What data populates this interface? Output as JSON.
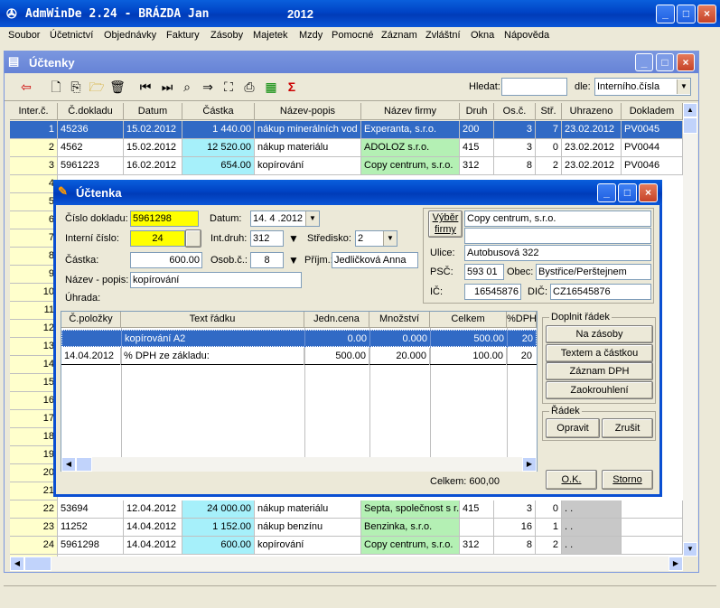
{
  "app": {
    "title": "AdmWinDe 2.24 - BRÁZDA Jan",
    "year": "2012"
  },
  "menu": [
    "Soubor",
    "Účetnictví",
    "Objednávky",
    "Faktury",
    "Zásoby",
    "Majetek",
    "Mzdy",
    "Pomocné",
    "Záznam",
    "Zvláštní",
    "Okna",
    "Nápověda"
  ],
  "child": {
    "title": "Účtenky",
    "search_label": "Hledat:",
    "search_value": "",
    "by_label": "dle:",
    "by_value": "Interního.čísla"
  },
  "columns": [
    "Inter.č.",
    "Č.dokladu",
    "Datum",
    "Částka",
    "Název-popis",
    "Název firmy",
    "Druh",
    "Os.č.",
    "Stř.",
    "Uhrazeno",
    "Dokladem"
  ],
  "rows_top": [
    {
      "n": "1",
      "doc": "45236",
      "date": "15.02.2012",
      "amt": "1 440.00",
      "desc": "nákup minerálních vod",
      "firm": "Experanta, s.r.o.",
      "druh": "200",
      "os": "3",
      "st": "7",
      "paid": "23.02.2012",
      "dokl": "PV0045"
    },
    {
      "n": "2",
      "doc": "4562",
      "date": "15.02.2012",
      "amt": "12 520.00",
      "desc": "nákup materiálu",
      "firm": "ADOLOZ s.r.o.",
      "druh": "415",
      "os": "3",
      "st": "0",
      "paid": "23.02.2012",
      "dokl": "PV0044"
    },
    {
      "n": "3",
      "doc": "5961223",
      "date": "16.02.2012",
      "amt": "654.00",
      "desc": "kopírování",
      "firm": "Copy centrum, s.r.o.",
      "druh": "312",
      "os": "8",
      "st": "2",
      "paid": "23.02.2012",
      "dokl": "PV0046"
    }
  ],
  "hidden_row_numbers": [
    "4",
    "5",
    "6",
    "7",
    "8",
    "9",
    "10",
    "11",
    "12",
    "13",
    "14",
    "15",
    "16",
    "17",
    "18",
    "19",
    "20",
    "21"
  ],
  "rows_bottom": [
    {
      "n": "22",
      "doc": "53694",
      "date": "12.04.2012",
      "amt": "24 000.00",
      "desc": "nákup materiálu",
      "firm": "Septa, společnost s r.o.",
      "druh": "415",
      "os": "3",
      "st": "0",
      "paid": ". .",
      "dokl": ""
    },
    {
      "n": "23",
      "doc": "11252",
      "date": "14.04.2012",
      "amt": "1 152.00",
      "desc": "nákup benzínu",
      "firm": "Benzinka, s.r.o.",
      "druh": "",
      "os": "16",
      "st": "1",
      "paid": ". .",
      "dokl": ""
    },
    {
      "n": "24",
      "doc": "5961298",
      "date": "14.04.2012",
      "amt": "600.00",
      "desc": "kopírování",
      "firm": "Copy centrum, s.r.o.",
      "druh": "312",
      "os": "8",
      "st": "2",
      "paid": ". .",
      "dokl": ""
    }
  ],
  "dialog": {
    "title": "Účtenka",
    "cislo_dokladu_label": "Číslo dokladu:",
    "cislo_dokladu": "5961298",
    "datum_label": "Datum:",
    "datum": "14. 4 .2012",
    "interni_cislo_label": "Interní číslo:",
    "interni_cislo": "24",
    "int_druh_label": "Int.druh:",
    "int_druh": "312",
    "stredisko_label": "Středisko:",
    "stredisko": "2",
    "castka_label": "Částka:",
    "castka": "600.00",
    "osob_label": "Osob.č.:",
    "osob": "8",
    "prijm_label": "Příjm.:",
    "prijm": "Jedličková Anna",
    "nazev_label": "Název - popis:",
    "nazev": "kopírování",
    "uhrada_label": "Úhrada:",
    "vyber_firmy": "Výběr firmy",
    "firma": "Copy centrum, s.r.o.",
    "firma2": "",
    "ulice_label": "Ulice:",
    "ulice": "Autobusová 322",
    "psc_label": "PSČ:",
    "psc": "593 01",
    "obec_label": "Obec:",
    "obec": "Bystřice/Perštejnem",
    "ic_label": "IČ:",
    "ic": "16545876",
    "dic_label": "DIČ:",
    "dic": "CZ16545876",
    "columns": [
      "Č.položky",
      "Text řádku",
      "Jedn.cena",
      "Množství",
      "Celkem",
      "%DPH"
    ],
    "rows": [
      {
        "pol": "",
        "text": "kopírování A2",
        "cena": "0.00",
        "mnoz": "0.000",
        "celkem": "500.00",
        "dph": "20"
      },
      {
        "pol": "14.04.2012",
        "text": "% DPH ze základu:",
        "cena": "500.00",
        "mnoz": "20.000",
        "celkem": "100.00",
        "dph": "20"
      }
    ],
    "doplnit_label": "Doplnit řádek",
    "na_zasoby": "Na zásoby",
    "textem": "Textem a částkou",
    "zaznam_dph": "Záznam DPH",
    "zaokrouhleni": "Zaokrouhlení",
    "radek_label": "Řádek",
    "opravit": "Opravit",
    "zrusit": "Zrušit",
    "celkem_text": "Celkem:  600,00",
    "ok": "O.K.",
    "storno": "Storno"
  },
  "colors": {
    "selected": "#316ac5",
    "yellow": "#ffff00",
    "cyan": "#a6f0fa",
    "green": "#b4f0b4",
    "gray": "#c8c8c8"
  }
}
